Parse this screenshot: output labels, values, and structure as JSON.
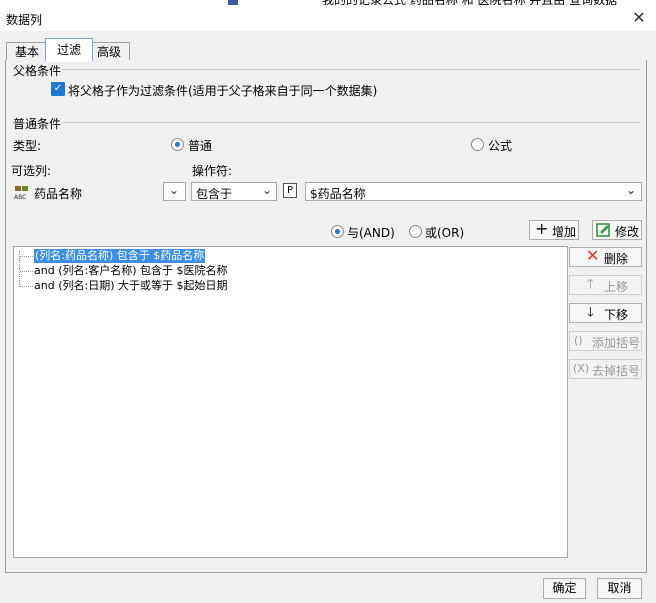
{
  "window": {
    "title": "数据列",
    "close_glyph": "✕"
  },
  "background": {
    "behind_text": "我的的记录公式 药品名称 和 医院名称 并且由 查询数据"
  },
  "tabs": [
    {
      "label": "基本",
      "active": false
    },
    {
      "label": "过滤",
      "active": true
    },
    {
      "label": "高级",
      "active": false
    }
  ],
  "parent_condition": {
    "section_label": "父格条件",
    "checkbox_label": "将父格子作为过滤条件(适用于父子格来自于同一个数据集)",
    "checked": true
  },
  "normal_condition": {
    "section_label": "普通条件",
    "type_label": "类型:",
    "type_options": [
      {
        "label": "普通",
        "selected": true
      },
      {
        "label": "公式",
        "selected": false
      }
    ],
    "column_label": "可选列:",
    "column_value": "药品名称",
    "column_icon": "abc-field-icon",
    "operator_label": "操作符:",
    "operator_value": "包含于",
    "param_icon_glyph": "P",
    "value_text": "$药品名称"
  },
  "logic": {
    "and_label": "与(AND)",
    "or_label": "或(OR)",
    "selected": "and"
  },
  "actions": {
    "add_label": "增加",
    "modify_label": "修改",
    "delete_label": "删除",
    "up_label": "上移",
    "down_label": "下移",
    "add_bracket_label": "添加括号",
    "remove_bracket_label": "去掉括号"
  },
  "conditions": [
    {
      "text": "(列名:药品名称) 包含于 $药品名称",
      "selected": true
    },
    {
      "text": "and (列名:客户名称) 包含于 $医院名称",
      "selected": false
    },
    {
      "text": "and (列名:日期) 大于或等于 $起始日期",
      "selected": false
    }
  ],
  "footer": {
    "ok_label": "确定",
    "cancel_label": "取消"
  },
  "colors": {
    "accent": "#1e7ad8",
    "selection": "#3b8fe6",
    "delete_red": "#e03030"
  }
}
